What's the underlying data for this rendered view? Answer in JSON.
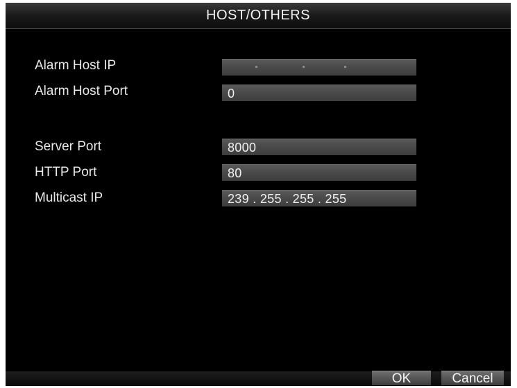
{
  "window": {
    "title": "HOST/OTHERS"
  },
  "fields": {
    "alarm_host_ip": {
      "label": "Alarm Host IP",
      "value": ""
    },
    "alarm_host_port": {
      "label": "Alarm Host Port",
      "value": "0"
    },
    "server_port": {
      "label": "Server Port",
      "value": "8000"
    },
    "http_port": {
      "label": "HTTP Port",
      "value": "80"
    },
    "multicast_ip": {
      "label": "Multicast IP",
      "value": "239 . 255 . 255 . 255"
    }
  },
  "buttons": {
    "ok": "OK",
    "cancel": "Cancel"
  }
}
